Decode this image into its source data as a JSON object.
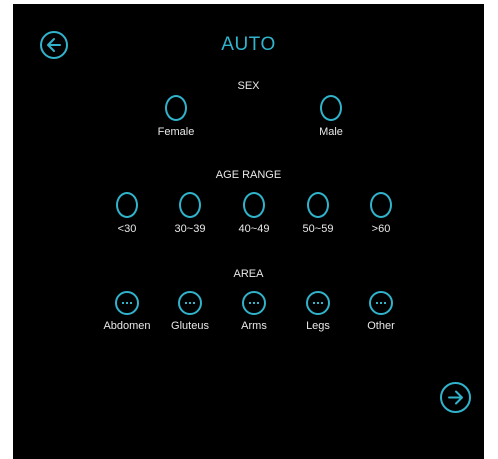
{
  "header": {
    "title": "AUTO",
    "back_icon": "arrow-left-circle-icon"
  },
  "sex": {
    "label": "SEX",
    "options": [
      "Female",
      "Male"
    ]
  },
  "age_range": {
    "label": "AGE RANGE",
    "options": [
      "<30",
      "30~39",
      "40~49",
      "50~59",
      ">60"
    ]
  },
  "area": {
    "label": "AREA",
    "options": [
      "Abdomen",
      "Gluteus",
      "Arms",
      "Legs",
      "Other"
    ]
  },
  "footer": {
    "next_icon": "arrow-right-circle-icon"
  },
  "colors": {
    "background": "#000000",
    "accent": "#31b3cc",
    "text": "#e8e8e8"
  }
}
